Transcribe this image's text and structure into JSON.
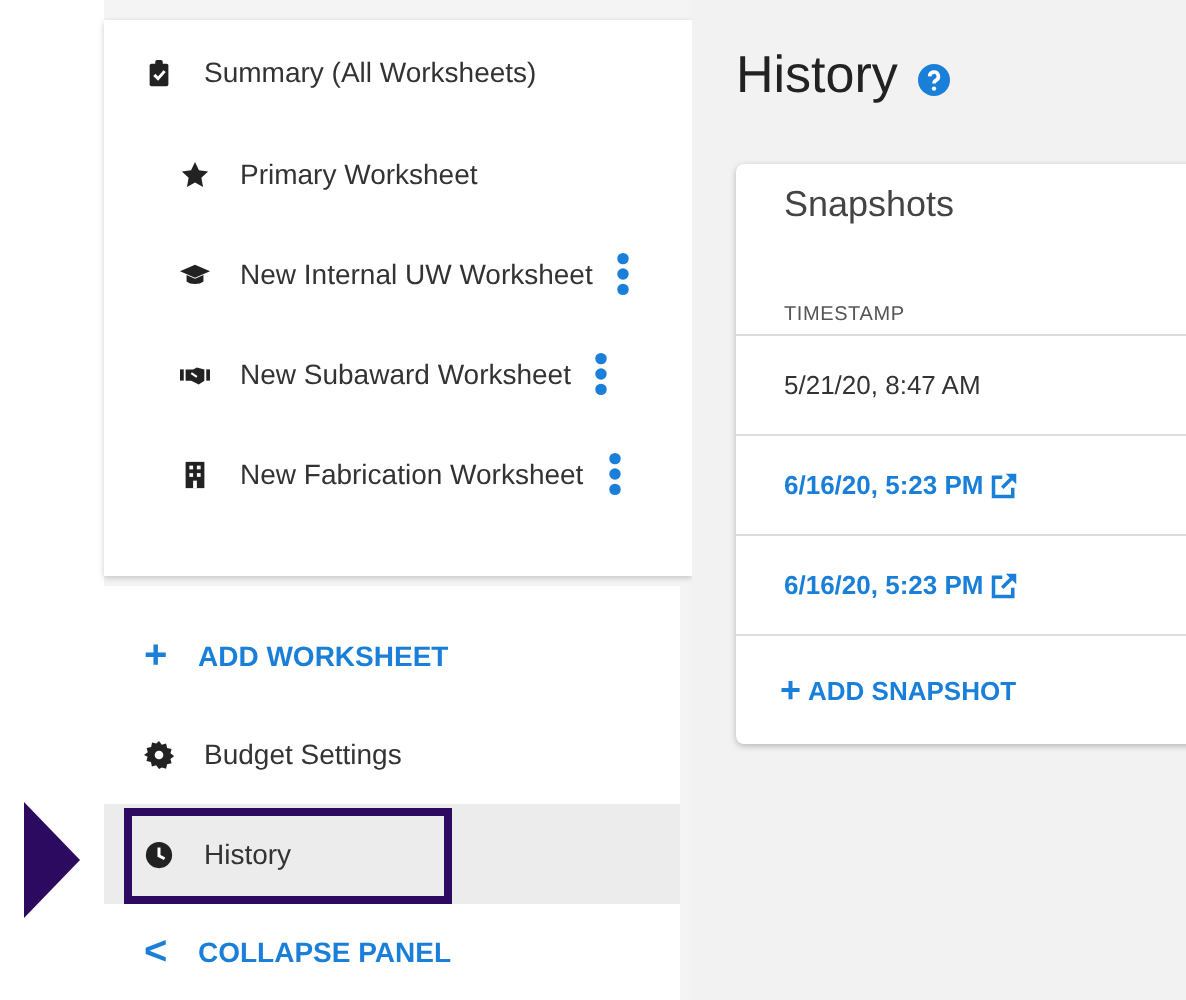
{
  "worksheets": {
    "label": "Summary (All Worksheets)",
    "kind": "clipboard",
    "children": [
      {
        "label": "Primary Worksheet",
        "kind": "star",
        "has_menu": false
      },
      {
        "label": "New Internal UW Worksheet",
        "kind": "cap",
        "has_menu": true
      },
      {
        "label": "New Subaward Worksheet",
        "kind": "handshake",
        "has_menu": true
      },
      {
        "label": "New Fabrication Worksheet",
        "kind": "building",
        "has_menu": true
      }
    ]
  },
  "add_worksheet": {
    "icon": "+",
    "label": "ADD WORKSHEET"
  },
  "nav": [
    {
      "label": "Budget Settings",
      "kind": "gear",
      "selected": false,
      "highlighted": false
    },
    {
      "label": "History",
      "kind": "clock",
      "selected": true,
      "highlighted": true
    }
  ],
  "collapse": {
    "icon": "<",
    "label": "COLLAPSE PANEL"
  },
  "page_title": "History",
  "snapshots": {
    "title": "Snapshots",
    "columns": [
      "TIMESTAMP"
    ],
    "rows": [
      {
        "kind": "plain",
        "timestamp": "5/21/20, 8:47 AM"
      },
      {
        "kind": "link",
        "timestamp": "6/16/20, 5:23 PM"
      },
      {
        "kind": "link",
        "timestamp": "6/16/20, 5:23 PM"
      }
    ],
    "add": {
      "icon": "+",
      "label": "ADD SNAPSHOT"
    }
  }
}
